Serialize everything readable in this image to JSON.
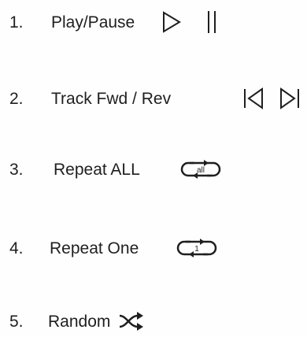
{
  "items": [
    {
      "number": "1.",
      "label": "Play/Pause",
      "icons": [
        "play-icon",
        "pause-icon"
      ]
    },
    {
      "number": "2.",
      "label": "Track Fwd / Rev",
      "icons": [
        "track-previous-icon",
        "track-next-icon"
      ]
    },
    {
      "number": "3.",
      "label": "Repeat ALL",
      "icons": [
        "repeat-all-icon"
      ],
      "icon_text": "all"
    },
    {
      "number": "4.",
      "label": "Repeat One",
      "icons": [
        "repeat-one-icon"
      ],
      "icon_text": "1"
    },
    {
      "number": "5.",
      "label": "Random",
      "icons": [
        "shuffle-icon"
      ]
    }
  ],
  "colors": {
    "ink": "#1f1f1f",
    "background": "#ffffff"
  }
}
